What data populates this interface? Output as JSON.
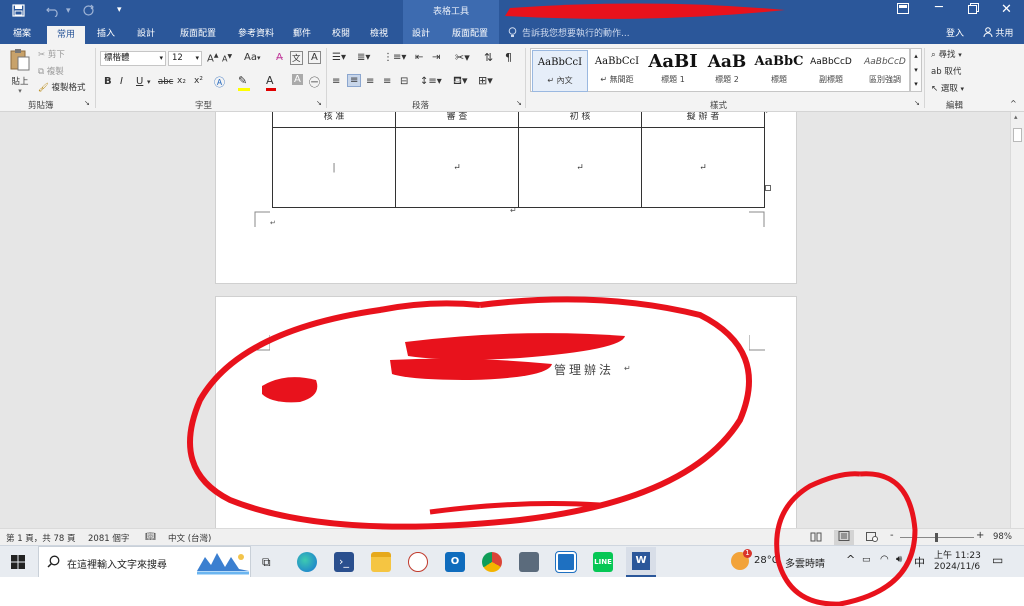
{
  "titlebar": {
    "context_title": "表格工具",
    "quick_access": [
      "save-icon",
      "undo-icon",
      "redo-icon",
      "customize-icon"
    ],
    "buttons": [
      "ribbon-display-icon",
      "minimize-icon",
      "restore-icon",
      "close-icon"
    ]
  },
  "tabs": {
    "file": "檔案",
    "home": "常用",
    "insert": "插入",
    "design": "設計",
    "layout": "版面配置",
    "references": "參考資料",
    "mailings": "郵件",
    "review": "校閱",
    "view": "檢視",
    "table_design": "設計",
    "table_layout": "版面配置",
    "tell_me": "告訴我您想要執行的動作...",
    "sign_in": "登入",
    "share": "共用"
  },
  "ribbon": {
    "clipboard": {
      "paste": "貼上",
      "cut": "剪下",
      "copy": "複製",
      "format_painter": "複製格式",
      "label": "剪貼簿"
    },
    "font": {
      "font_name": "標楷體",
      "font_size": "12",
      "grow": "A",
      "shrink": "A",
      "case": "Aa",
      "label": "字型",
      "bold": "B",
      "italic": "I",
      "underline": "U",
      "strike": "abc",
      "subscript": "x₂",
      "superscript": "x²",
      "font_color": "A"
    },
    "paragraph": {
      "label": "段落"
    },
    "styles": {
      "label": "樣式",
      "items": [
        {
          "sample": "AaBbCcI",
          "name": "↵ 內文"
        },
        {
          "sample": "AaBbCcI",
          "name": "↵ 無間距"
        },
        {
          "sample": "AaBI",
          "name": "標題 1"
        },
        {
          "sample": "AaB",
          "name": "標題 2"
        },
        {
          "sample": "AaBbC",
          "name": "標題"
        },
        {
          "sample": "AaBbCcD",
          "name": "副標題"
        },
        {
          "sample": "AaBbCcD",
          "name": "區別強調"
        }
      ]
    },
    "editing": {
      "find": "尋找",
      "replace": "取代",
      "select": "選取",
      "label": "編輯"
    }
  },
  "document": {
    "table_header": [
      "核 准",
      "審 查",
      "初 核",
      "擬 辦 者"
    ],
    "table_cell_mark": "↵",
    "after_table_mark": "↵",
    "page2_visible_text": "管理辦法",
    "paragraph_mark": "↵"
  },
  "statusbar": {
    "page": "第 1 頁，共 78 頁",
    "words": "2081 個字",
    "language": "中文 (台灣)",
    "zoom": "98%",
    "zoom_minus": "-",
    "zoom_plus": "+",
    "zoom_level": 0.49
  },
  "taskbar": {
    "search_placeholder": "在這裡輸入文字來搜尋",
    "weather_temp": "28°C",
    "weather_text": "多雲時晴",
    "ime": "中",
    "time": "上午 11:23",
    "date": "2024/11/6",
    "weather_badge": "1"
  },
  "colors": {
    "accent": "#2b579a",
    "context_tab": "#3d6bb0",
    "annotation": "#e8121c"
  }
}
